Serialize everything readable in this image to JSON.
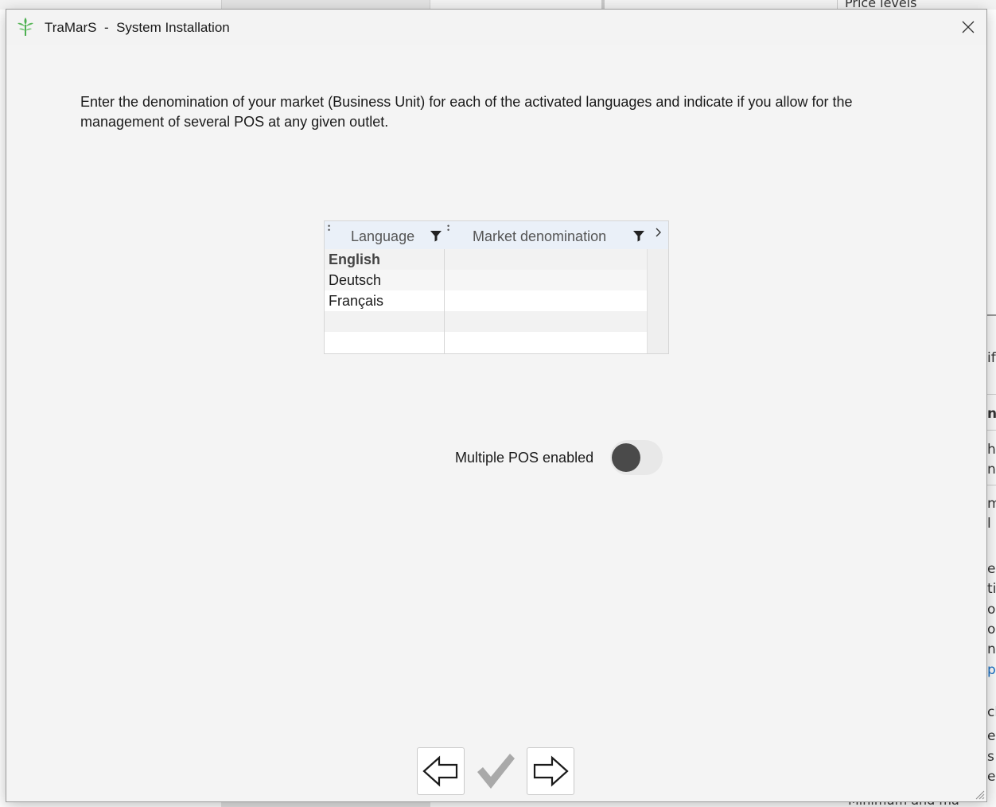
{
  "background": {
    "tab_label": "Price levels",
    "right_fragments": [
      "if",
      "n",
      "he",
      "na",
      "m",
      "l",
      "en",
      "ti",
      "or",
      "o",
      "n",
      "p",
      "ch",
      "ec",
      "s",
      "e"
    ],
    "bottom_fragment": "Minimum and ma"
  },
  "window": {
    "app_name": "TraMarS",
    "separator": "  -  ",
    "title": "System Installation"
  },
  "intro": "Enter the denomination of your market (Business Unit) for each of the activated languages and indicate if you allow for the management of several POS at any given outlet.",
  "grid": {
    "columns": [
      {
        "label": "Language"
      },
      {
        "label": "Market denomination"
      }
    ],
    "rows": [
      {
        "language": "English",
        "market": ""
      },
      {
        "language": "Deutsch",
        "market": ""
      },
      {
        "language": "Français",
        "market": ""
      },
      {
        "language": "",
        "market": ""
      },
      {
        "language": "",
        "market": ""
      }
    ]
  },
  "multiple_pos": {
    "label": "Multiple POS enabled",
    "enabled": false
  },
  "colors": {
    "dialog_bg": "#f4f4f4",
    "grid_header_bg": "#eaf0f8",
    "toggle_knob": "#4a4a4a",
    "check_disabled": "#a9a9a9",
    "app_icon_green": "#4caf50"
  }
}
